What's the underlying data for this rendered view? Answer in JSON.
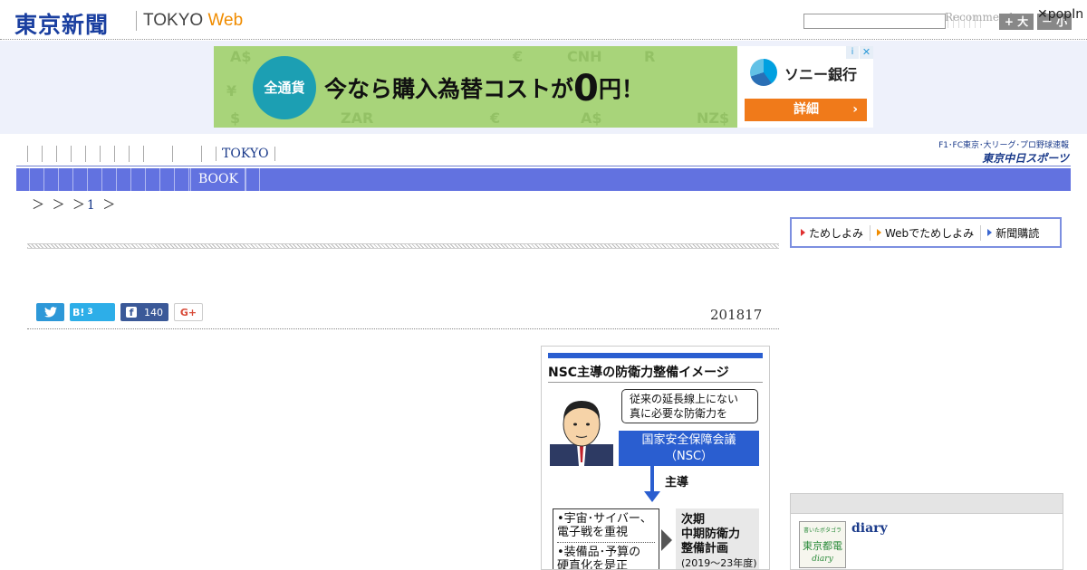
{
  "header": {
    "logo": "東京新聞",
    "logo_sub_tokyo": "TOKYO",
    "logo_sub_web": "Web",
    "recommend_label": "Recommend",
    "recommend_count": "0",
    "font_large": "+ 大",
    "font_small": "－ 小",
    "popin": "✕popIn",
    "search_placeholder": ""
  },
  "ad": {
    "circle_text": "全通貨",
    "headline": "今なら購入為替コストが",
    "headline_big": "0",
    "headline_tail": "円！",
    "advertiser": "ソニー銀行",
    "cta": "詳細",
    "cta_arrow": "›",
    "info_icon": "i",
    "close_icon": "✕",
    "bg_symbols": [
      "A$",
      "¥",
      "CNH",
      "R",
      "$",
      "ZAR",
      "€",
      "A$",
      "NZ$",
      "€"
    ],
    "colors": {
      "bg": "#a8d47a",
      "circle": "#1c9fb3",
      "cta": "#f07a1a"
    }
  },
  "nav": {
    "tokyo_tab": "TOKYO",
    "book_tab": "BOOK",
    "chunichi_line1": "F1･FC東京･大リーグ･プロ野球速報",
    "chunichi_line2": "東京中日スポーツ"
  },
  "breadcrumb": {
    "prefix": "＞ ＞ ＞",
    "page": "1",
    "suffix": "＞"
  },
  "subscribe": {
    "items": [
      "ためしよみ",
      "Webでためしよみ",
      "新聞購読"
    ]
  },
  "share": {
    "twitter_icon": "twitter-bird-icon",
    "hatena_label": "B!",
    "hatena_count": "3",
    "facebook_icon": "f",
    "facebook_count": "140",
    "gplus_label": "G+"
  },
  "article": {
    "date": "201817"
  },
  "figure": {
    "title": "NSC主導の防衛力整備イメージ",
    "bubble_line1": "従来の延長線上にない",
    "bubble_line2": "真に必要な防衛力を",
    "nsc_line1": "国家安全保障会議",
    "nsc_line2": "（NSC）",
    "lead": "主導",
    "item1_line1": "•宇宙･サイバー、",
    "item1_line2": "電子戦を重視",
    "item2_line1": "•装備品･予算の",
    "item2_line2": "硬直化を是正",
    "plan_line1": "次期",
    "plan_line2": "中期防衛力",
    "plan_line3": "整備計画",
    "plan_years": "(2019～23年度)",
    "colors": {
      "accent": "#2a5ed0"
    }
  },
  "diary": {
    "thumb_line1": "書いたボタゴラ",
    "thumb_line2": "東京都電",
    "thumb_line3": "diary",
    "title": "diary"
  }
}
